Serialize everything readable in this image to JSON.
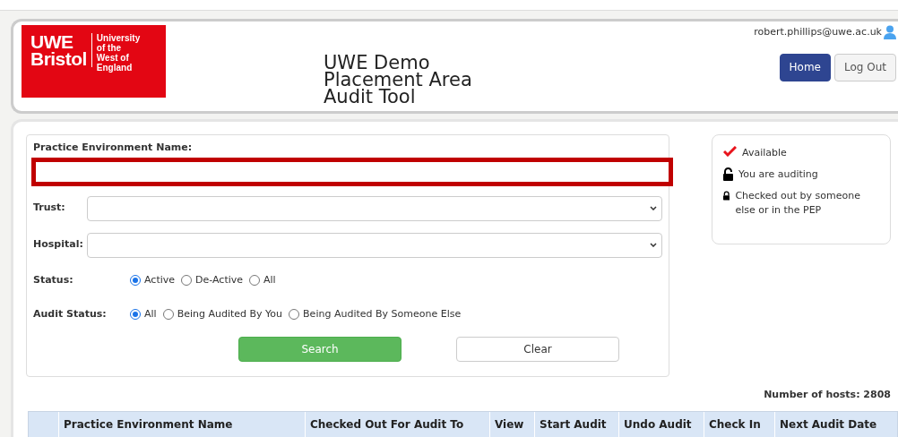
{
  "logo": {
    "name_lines": [
      "UWE",
      "Bristol"
    ],
    "sub_lines": [
      "University",
      "of the",
      "West of",
      "England"
    ]
  },
  "title_lines": [
    "UWE Demo",
    "Placement Area",
    "Audit Tool"
  ],
  "user": {
    "email": "robert.phillips@uwe.ac.uk"
  },
  "nav_buttons": [
    {
      "label": "Home",
      "selected": true
    },
    {
      "label": "Log Out",
      "selected": false
    }
  ],
  "form": {
    "name_label": "Practice Environment Name:",
    "trust_label": "Trust:",
    "hospital_label": "Hospital:",
    "status": {
      "label": "Status:",
      "options": [
        {
          "label": "Active",
          "selected": true
        },
        {
          "label": "De-Active",
          "selected": false
        },
        {
          "label": "All",
          "selected": false
        }
      ]
    },
    "audit_status": {
      "label": "Audit Status:",
      "options": [
        {
          "label": "All",
          "selected": true
        },
        {
          "label": "Being Audited By You",
          "selected": false
        },
        {
          "label": "Being Audited By Someone Else",
          "selected": false
        }
      ]
    },
    "buttons": [
      {
        "label": "Search",
        "kind": "primary"
      },
      {
        "label": "Clear",
        "kind": "secondary"
      }
    ]
  },
  "legend": [
    {
      "kind": "check",
      "text": "Available"
    },
    {
      "kind": "unlocked",
      "text": "You are auditing"
    },
    {
      "kind": "locked",
      "text": "Checked out by someone else or in the PEP"
    }
  ],
  "hosts_count": "Number of hosts: 2808",
  "table": {
    "columns": [
      "",
      "Practice Environment Name",
      "Checked Out For Audit To",
      "View",
      "Start Audit",
      "Undo Audit",
      "Check In",
      "Next Audit Date"
    ]
  }
}
